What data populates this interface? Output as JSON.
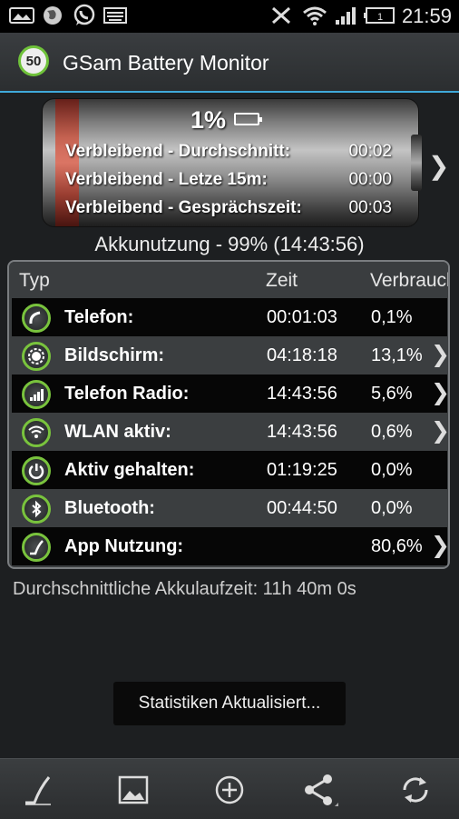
{
  "status_bar": {
    "time": "21:59",
    "battery_level_label": "1",
    "icons": [
      "picture-icon",
      "globe-icon",
      "whatsapp-icon",
      "keyboard-icon",
      "mute-icon",
      "wifi-icon",
      "signal-icon",
      "battery-icon"
    ]
  },
  "app": {
    "title": "GSam Battery Monitor",
    "logo_label": "50"
  },
  "battery": {
    "percent": "1%",
    "fill_level": 0.01,
    "rows": [
      {
        "label": "Verbleibend - Durchschnitt:",
        "value": "00:02"
      },
      {
        "label": "Verbleibend - Letze 15m:",
        "value": "00:00"
      },
      {
        "label": "Verbleibend - Gesprächszeit:",
        "value": "00:03"
      }
    ]
  },
  "usage_summary": "Akkunutzung - 99% (14:43:56)",
  "table": {
    "headers": {
      "type": "Typ",
      "time": "Zeit",
      "consumption": "Verbrauch"
    },
    "rows": [
      {
        "icon": "phone-icon",
        "name": "Telefon:",
        "time": "00:01:03",
        "percent": "0,1%",
        "has_detail": false
      },
      {
        "icon": "brightness-icon",
        "name": "Bildschirm:",
        "time": "04:18:18",
        "percent": "13,1%",
        "has_detail": true
      },
      {
        "icon": "signal-bars-icon",
        "name": "Telefon Radio:",
        "time": "14:43:56",
        "percent": "5,6%",
        "has_detail": true
      },
      {
        "icon": "wifi-icon",
        "name": "WLAN aktiv:",
        "time": "14:43:56",
        "percent": "0,6%",
        "has_detail": true
      },
      {
        "icon": "power-icon",
        "name": "Aktiv gehalten:",
        "time": "01:19:25",
        "percent": "0,0%",
        "has_detail": false
      },
      {
        "icon": "bluetooth-icon",
        "name": "Bluetooth:",
        "time": "00:44:50",
        "percent": "0,0%",
        "has_detail": false
      },
      {
        "icon": "app-usage-icon",
        "name": "App Nutzung:",
        "time": "",
        "percent": "80,6%",
        "has_detail": true
      }
    ]
  },
  "average_runtime": "Durchschnittliche Akkulaufzeit: 11h 40m 0s",
  "toast": "Statistiken Aktualisiert...",
  "bottom_bar": {
    "buttons": [
      "graph-icon",
      "image-icon",
      "add-icon",
      "share-icon",
      "refresh-icon"
    ]
  },
  "colors": {
    "accent": "#3fa9d9",
    "icon_ring": "#79c33d",
    "battery_fill": "#c85a47"
  }
}
